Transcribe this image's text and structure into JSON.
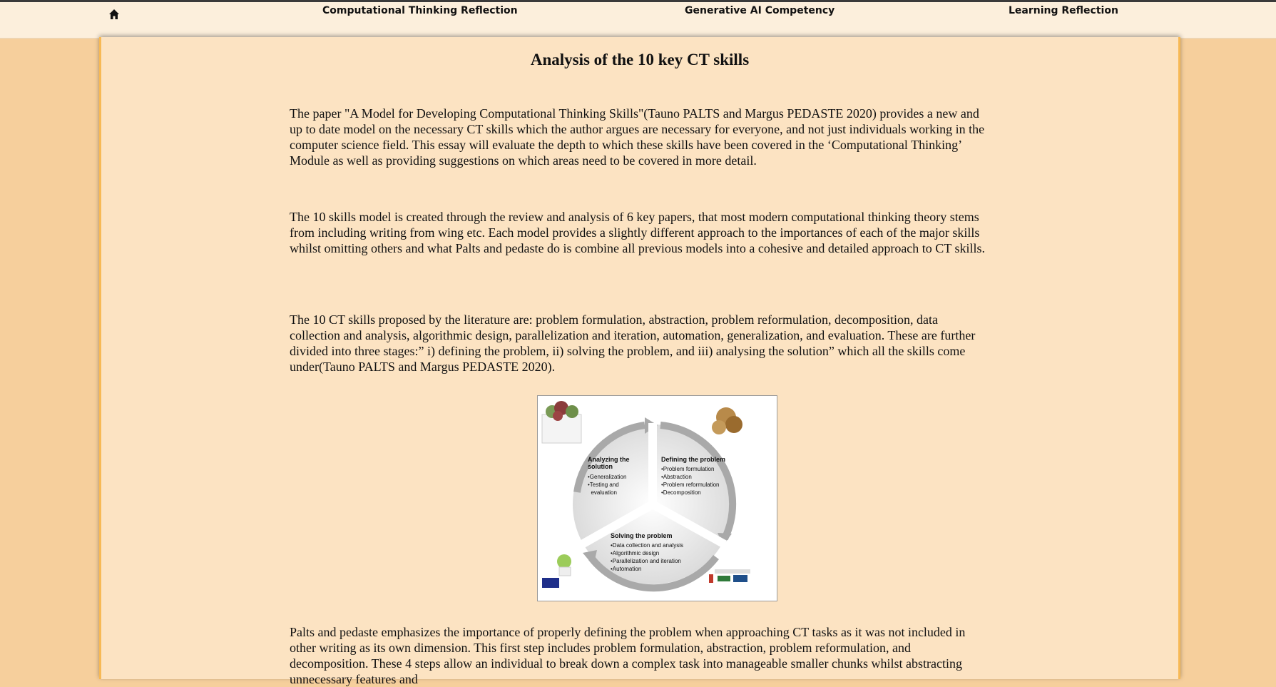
{
  "nav": {
    "home_icon": "home-icon",
    "links": [
      "Computational Thinking Reflection",
      "Generative AI Competency",
      "Learning Reflection"
    ]
  },
  "page": {
    "title": "Analysis of the 10 key CT skills",
    "paragraphs": [
      "The paper \"A Model for Developing Computational Thinking Skills\"(Tauno PALTS and Margus PEDASTE 2020) provides a new and up to date model on the necessary CT skills which the author argues are necessary for everyone, and not just individuals working in the computer science field. This essay will evaluate the depth to which these skills have been covered in the ‘Computational Thinking’ Module as well as providing suggestions on which areas need to be covered in more detail.",
      "The 10 skills model is created through the review and analysis of 6 key papers, that most modern computational thinking theory stems from including writing from wing etc. Each model provides a slightly different approach to the importances of each of the major skills whilst omitting others and what Palts and pedaste do is combine all previous models into a cohesive and detailed approach to CT skills.",
      "The 10 CT skills proposed by the literature are: problem formulation, abstraction, problem reformulation, decomposition, data collection and analysis, algorithmic design, parallelization and iteration, automation, generalization, and evaluation. These are further divided into three stages:” i) defining the problem, ii) solving the problem, and iii) analysing the solution” which all the skills come under(Tauno PALTS and Margus PEDASTE 2020).",
      "Palts and pedaste emphasizes the importance of properly defining the problem when approaching CT tasks as it was not included in other writing as its own dimension. This first step includes problem formulation, abstraction, problem reformulation, and decomposition. These 4 steps allow an individual to break down a complex task into manageable smaller chunks whilst abstracting unnecessary features and"
    ]
  },
  "figure": {
    "stages": [
      {
        "title_lines": [
          "Analyzing the",
          "solution"
        ],
        "items": [
          "•Generalization",
          "•Testing and",
          "  evaluation"
        ]
      },
      {
        "title_lines": [
          "Defining the problem"
        ],
        "items": [
          "•Problem formulation",
          "•Abstraction",
          "•Problem reformulation",
          "•Decomposition"
        ]
      },
      {
        "title_lines": [
          "Solving the problem"
        ],
        "items": [
          "•Data collection and analysis",
          "•Algorithmic design",
          "•Parallelization and iteration",
          "•Automation"
        ]
      }
    ]
  },
  "colors": {
    "page_bg": "#f6cf9c",
    "content_bg": "#fce3c2",
    "nav_bg": "#fcefdc",
    "accent_border": "#f7b955"
  }
}
